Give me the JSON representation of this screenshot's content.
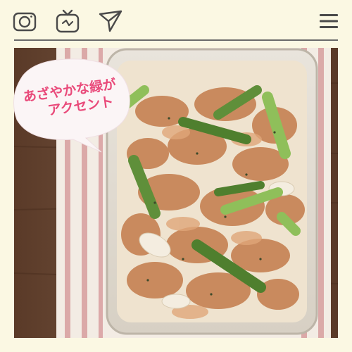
{
  "toolbar": {
    "icons": [
      "camera-icon",
      "tv-icon",
      "send-icon",
      "menu-icon"
    ],
    "icon_color": "#4a4a4a"
  },
  "post": {
    "caption_line1": "あざやかな緑が",
    "caption_line2": "アクセント",
    "caption_color": "#e94a7a"
  },
  "colors": {
    "background": "#fbf8e3",
    "divider": "#6a6a6a"
  }
}
